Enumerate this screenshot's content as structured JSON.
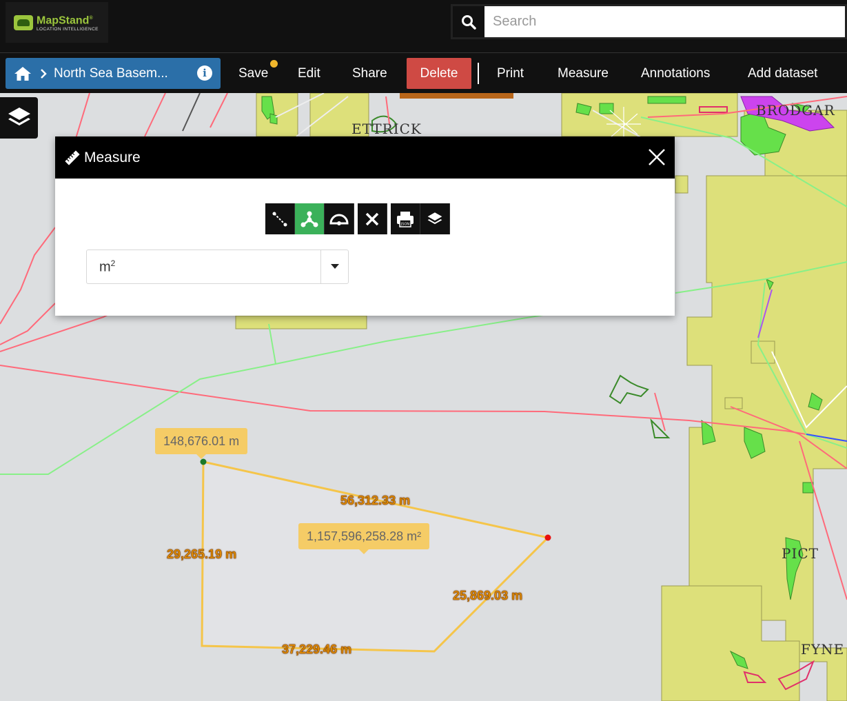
{
  "header": {
    "logo_name": "MapStand",
    "logo_sub": "LOCATION INTELLIGENCE",
    "search_placeholder": "Search"
  },
  "toolbar": {
    "breadcrumb_title": "North Sea Basem...",
    "save": "Save",
    "edit": "Edit",
    "share": "Share",
    "delete": "Delete",
    "print": "Print",
    "measure": "Measure",
    "annotations": "Annotations",
    "add_dataset": "Add dataset"
  },
  "measure_panel": {
    "title": "Measure",
    "unit_base": "m",
    "unit_exp": "2"
  },
  "measurements": {
    "total_length": "148,676.01 m",
    "area": "1,157,596,258.28 m²",
    "segments": [
      "56,312.33 m",
      "29,265.19 m",
      "25,869.03 m",
      "37,229.46 m"
    ]
  },
  "map_labels": [
    "ETTRICK",
    "BRODGAR",
    "PICT",
    "FYNE"
  ],
  "colors": {
    "accent_blue": "#2b6fa8",
    "delete_red": "#cf4a44",
    "active_green": "#3bb15a",
    "tooltip_yellow": "#f5cc66",
    "license_fill": "#dde07a"
  }
}
